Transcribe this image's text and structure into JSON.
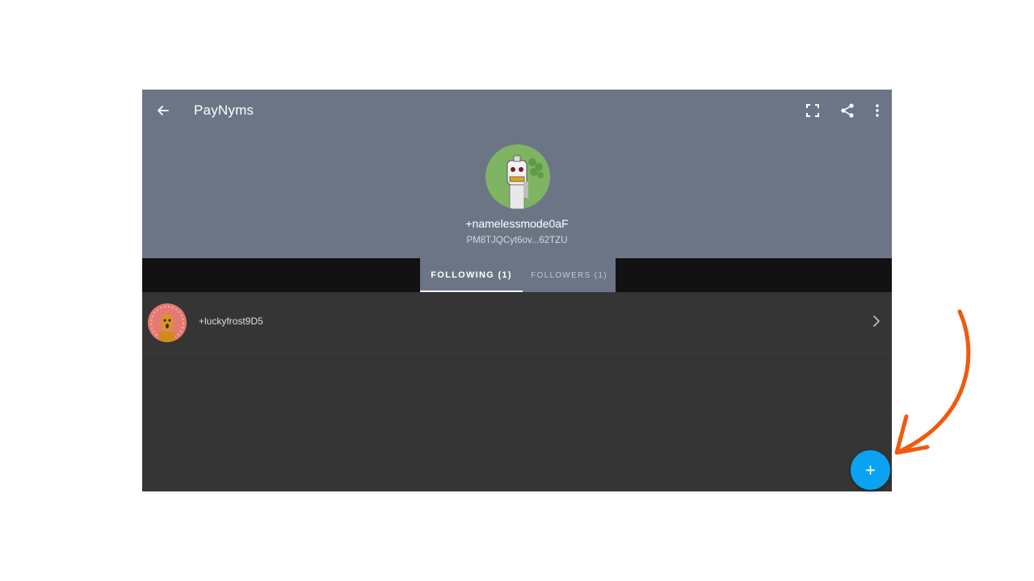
{
  "header": {
    "title": "PayNyms",
    "back_icon": "arrow-left-icon",
    "tools": [
      "scan-qr-icon",
      "share-icon",
      "more-vert-icon"
    ],
    "background_color": "#6c7586"
  },
  "profile": {
    "nym_name": "+namelessmode0aF",
    "payment_code": "PM8TJQCyt6ov...62TZU"
  },
  "tabs": [
    {
      "label": "FOLLOWING  (1)",
      "active": true
    },
    {
      "label": "FOLLOWERS  (1)",
      "active": false
    }
  ],
  "following": [
    {
      "name": "+luckyfrost9D5"
    }
  ],
  "fab": {
    "label": "+",
    "color": "#0ba3f1"
  },
  "annotation": {
    "color": "#f05a0e"
  }
}
